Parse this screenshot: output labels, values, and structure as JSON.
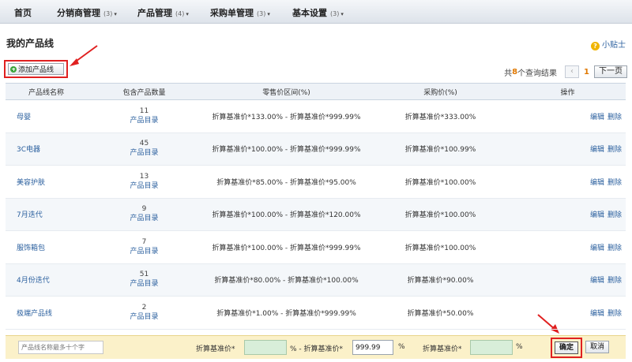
{
  "nav": {
    "items": [
      {
        "label": "首页",
        "count": "",
        "arrow": ""
      },
      {
        "label": "分销商管理",
        "count": "(3)",
        "arrow": "▾"
      },
      {
        "label": "产品管理",
        "count": "(4)",
        "arrow": "▾"
      },
      {
        "label": "采购单管理",
        "count": "(3)",
        "arrow": "▾"
      },
      {
        "label": "基本设置",
        "count": "(3)",
        "arrow": "▾"
      }
    ]
  },
  "page": {
    "title": "我的产品线",
    "tips": "小贴士",
    "add_button": "添加产品线"
  },
  "pager": {
    "prefix": "共",
    "total": "8",
    "suffix": "个查询结果",
    "prev": "‹",
    "current": "1",
    "next": "下一页"
  },
  "table": {
    "headers": [
      "产品线名称",
      "包含产品数量",
      "零售价区间(%)",
      "采购价(%)",
      "操作"
    ],
    "catalog_label": "产品目录",
    "edit_label": "编辑",
    "delete_label": "删除",
    "rows": [
      {
        "name": "母婴",
        "count": "11",
        "retail": "折算基准价*133.00% - 折算基准价*999.99%",
        "purchase": "折算基准价*333.00%"
      },
      {
        "name": "3C电器",
        "count": "45",
        "retail": "折算基准价*100.00% - 折算基准价*999.99%",
        "purchase": "折算基准价*100.99%"
      },
      {
        "name": "美容护肤",
        "count": "13",
        "retail": "折算基准价*85.00% - 折算基准价*95.00%",
        "purchase": "折算基准价*100.00%"
      },
      {
        "name": "7月迭代",
        "count": "9",
        "retail": "折算基准价*100.00% - 折算基准价*120.00%",
        "purchase": "折算基准价*100.00%"
      },
      {
        "name": "服饰箱包",
        "count": "7",
        "retail": "折算基准价*100.00% - 折算基准价*999.99%",
        "purchase": "折算基准价*100.00%"
      },
      {
        "name": "4月份迭代",
        "count": "51",
        "retail": "折算基准价*80.00% - 折算基准价*100.00%",
        "purchase": "折算基准价*90.00%"
      },
      {
        "name": "极端产品线",
        "count": "2",
        "retail": "折算基准价*1.00% - 折算基准价*999.99%",
        "purchase": "折算基准价*50.00%"
      }
    ]
  },
  "edit_row": {
    "name_placeholder": "产品线名称最多十个字",
    "label_retail_min": "折算基准价*",
    "pct_dash": "% - 折算基准价*",
    "retail_max_value": "999.99",
    "pct": "%",
    "label_purchase": "折算基准价*",
    "confirm": "确定",
    "cancel": "取消"
  },
  "colors": {
    "annotation": "#e02020",
    "link": "#2a5f9e",
    "accent": "#e07800",
    "edit_row_bg": "#fbf1c9",
    "input_green": "#d8eed9"
  }
}
